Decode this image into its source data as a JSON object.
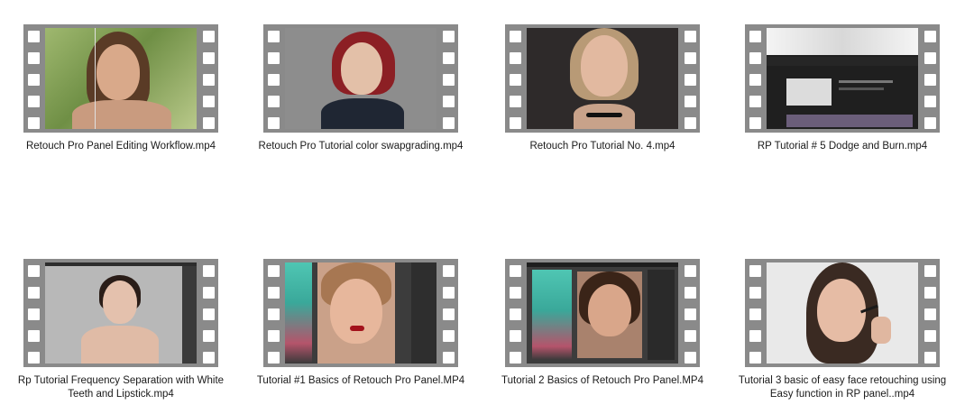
{
  "videos": [
    {
      "filename": "Retouch Pro Panel Editing Workflow.mp4",
      "thumbnail": "portrait-outdoor-split-before-after"
    },
    {
      "filename": "Retouch Pro Tutorial color swapgrading.mp4",
      "thumbnail": "portrait-red-bob-hair"
    },
    {
      "filename": "Retouch Pro Tutorial No. 4.mp4",
      "thumbnail": "portrait-blonde-choker"
    },
    {
      "filename": "RP Tutorial # 5 Dodge and Burn.mp4",
      "thumbnail": "youtube-channel-page"
    },
    {
      "filename": "Rp Tutorial Frequency Separation with White Teeth and Lipstick.mp4",
      "thumbnail": "photoshop-portrait-grey-bg"
    },
    {
      "filename": "Tutorial #1 Basics of Retouch Pro Panel.MP4",
      "thumbnail": "photoshop-panel-red-lips"
    },
    {
      "filename": "Tutorial 2 Basics of Retouch Pro Panel.MP4",
      "thumbnail": "photoshop-panel-freckles"
    },
    {
      "filename": "Tutorial 3 basic of easy face retouching using Easy function in RP panel..mp4",
      "thumbnail": "portrait-mascara"
    }
  ],
  "icon": "film-strip-icon",
  "colors": {
    "reel": "#8a8a8a",
    "hole": "#ffffff",
    "text": "#1a1a1a",
    "background": "#ffffff"
  }
}
